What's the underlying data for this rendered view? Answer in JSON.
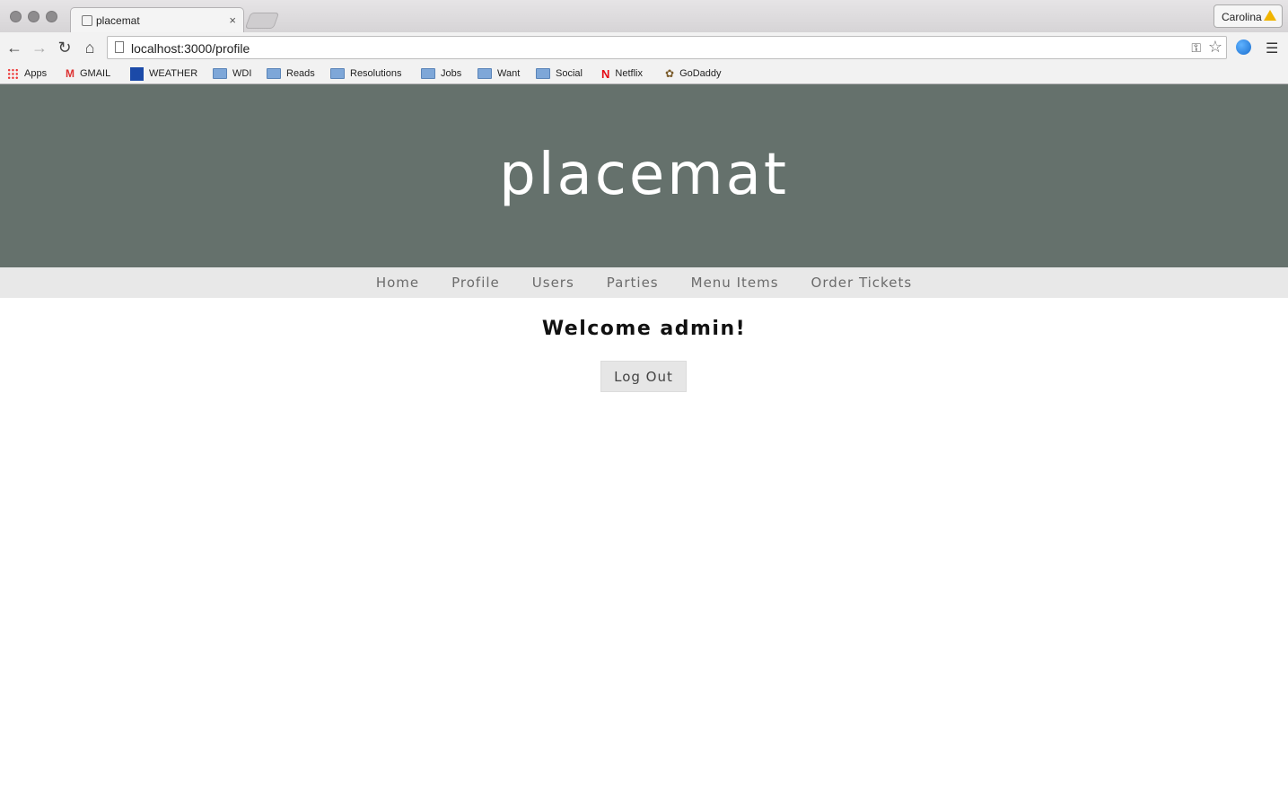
{
  "browser": {
    "tab_title": "placemat",
    "profile_name": "Carolina",
    "url": "localhost:3000/profile",
    "bookmarks": [
      {
        "label": "Apps",
        "icon": "apps-icon"
      },
      {
        "label": "GMAIL",
        "icon": "gmail-icon"
      },
      {
        "label": "WEATHER",
        "icon": "weather-icon"
      },
      {
        "label": "WDI",
        "icon": "folder-icon"
      },
      {
        "label": "Reads",
        "icon": "folder-icon"
      },
      {
        "label": "Resolutions",
        "icon": "folder-icon"
      },
      {
        "label": "Jobs",
        "icon": "folder-icon"
      },
      {
        "label": "Want",
        "icon": "folder-icon"
      },
      {
        "label": "Social",
        "icon": "folder-icon"
      },
      {
        "label": "Netflix",
        "icon": "netflix-icon"
      },
      {
        "label": "GoDaddy",
        "icon": "godaddy-icon"
      }
    ]
  },
  "site": {
    "logo": "placemat",
    "nav": [
      "Home",
      "Profile",
      "Users",
      "Parties",
      "Menu Items",
      "Order Tickets"
    ],
    "welcome": "Welcome admin!",
    "logout_label": "Log Out"
  },
  "colors": {
    "hero_bg": "#65716c",
    "nav_bg": "#e8e8e8"
  }
}
